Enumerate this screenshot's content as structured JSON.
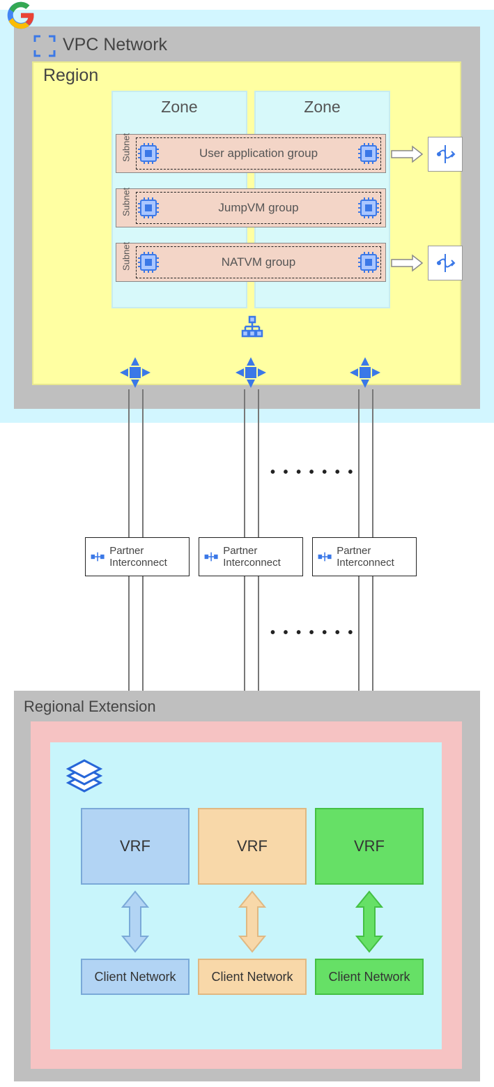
{
  "top": {
    "vpc_title": "VPC Network",
    "region_title": "Region",
    "zone_title": "Zone",
    "subnet_label": "Subnet",
    "rows": {
      "user_app": "User application group",
      "jumpvm": "JumpVM group",
      "natvm": "NATVM group"
    }
  },
  "interconnect": {
    "label": "Partner Interconnect"
  },
  "extension": {
    "title": "Regional Extension",
    "vrf": "VRF",
    "client": "Client Network"
  },
  "colors": {
    "blue": "#b2d4f4",
    "orange": "#f8d8a9",
    "green": "#66e066"
  }
}
